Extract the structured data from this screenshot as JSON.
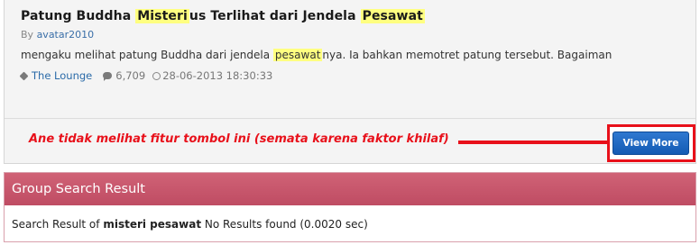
{
  "thread": {
    "title_parts": [
      "Patung Buddha ",
      "Misteri",
      "us Terlihat dari Jendela ",
      "Pesawat"
    ],
    "by_label": "By ",
    "author": "avatar2010",
    "snippet_parts": [
      "mengaku melihat patung Buddha dari jendela ",
      "pesawat",
      "nya. Ia bahkan memotret patung tersebut. Bagaiman"
    ],
    "forum": "The Lounge",
    "replies": "6,709",
    "date": "28-06-2013 18:30:33"
  },
  "annotation": {
    "text": "Ane tidak melihat fitur tombol ini (semata karena faktor khilaf)",
    "color": "#e8101a"
  },
  "view_more_label": "View More",
  "group_search": {
    "header": "Group Search Result",
    "prefix": "Search Result of ",
    "query": "misteri pesawat",
    "suffix": " No Results found (0.0020 sec)"
  },
  "colors": {
    "highlight": "#ffff80",
    "link": "#2a6aa8",
    "button": "#135bb4",
    "group_header": "#c85569"
  }
}
